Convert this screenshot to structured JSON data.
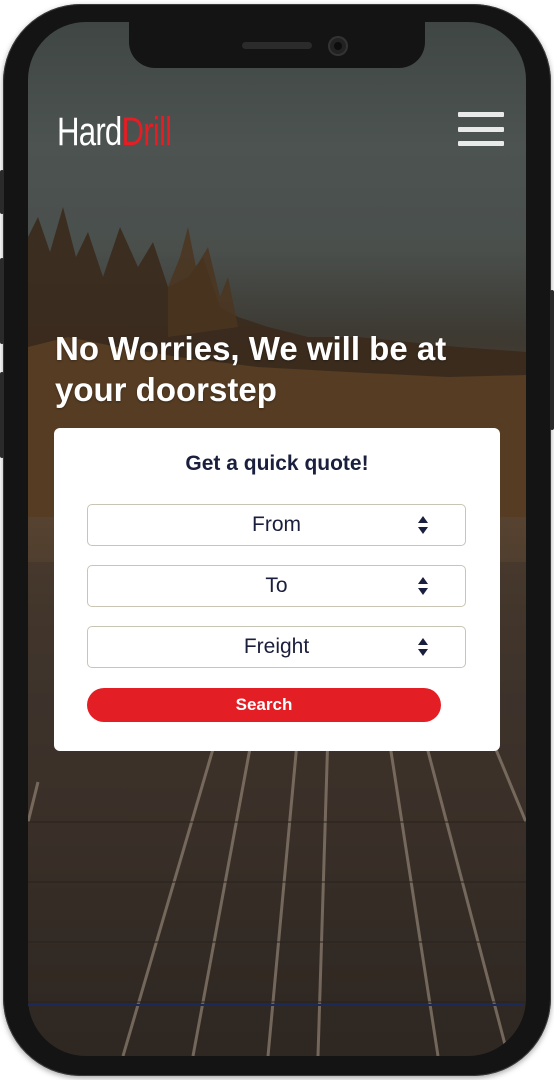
{
  "app": {
    "logo_part1": "Hard",
    "logo_part2": "Drill"
  },
  "hero": {
    "headline": "No Worries, We will be at your doorstep"
  },
  "quote_form": {
    "title": "Get a quick quote!",
    "from_placeholder": "From",
    "to_placeholder": "To",
    "freight_placeholder": "Freight",
    "search_label": "Search"
  },
  "colors": {
    "brand_red": "#e31e24",
    "text_navy": "#1a1f3d",
    "white": "#ffffff"
  },
  "icons": {
    "menu": "hamburger-menu-icon",
    "select_arrows": "sort-arrows-icon"
  }
}
